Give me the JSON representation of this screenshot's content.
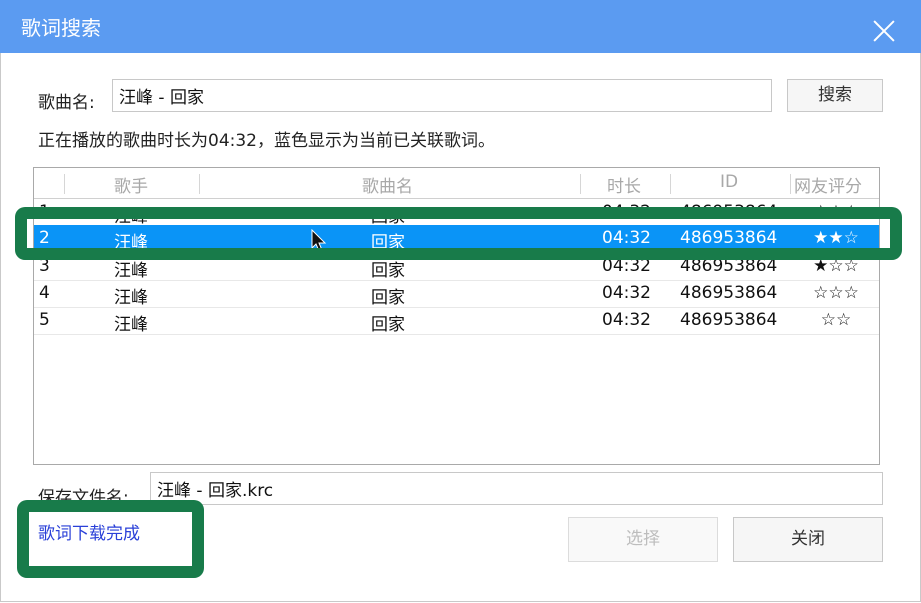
{
  "window": {
    "title": "歌词搜索",
    "close_icon": "close-icon"
  },
  "search": {
    "label": "歌曲名:",
    "value": "汪峰 - 回家",
    "button": "搜索"
  },
  "info_text": "正在播放的歌曲时长为04:32，蓝色显示为当前已关联歌词。",
  "table": {
    "columns": [
      "歌手",
      "歌曲名",
      "时长",
      "ID",
      "网友评分"
    ],
    "rows": [
      {
        "index": "1",
        "singer": "汪峰",
        "song": "回家",
        "duration": "04:32",
        "id": "486953864",
        "rating": "☆☆☆"
      },
      {
        "index": "2",
        "singer": "汪峰",
        "song": "回家",
        "duration": "04:32",
        "id": "486953864",
        "rating": "★★☆",
        "selected": true
      },
      {
        "index": "3",
        "singer": "汪峰",
        "song": "回家",
        "duration": "04:32",
        "id": "486953864",
        "rating": "★☆☆"
      },
      {
        "index": "4",
        "singer": "汪峰",
        "song": "回家",
        "duration": "04:32",
        "id": "486953864",
        "rating": "☆☆☆"
      },
      {
        "index": "5",
        "singer": "汪峰",
        "song": "回家",
        "duration": "04:32",
        "id": "486953864",
        "rating": "☆☆"
      }
    ]
  },
  "save": {
    "label": "保存文件名:",
    "value": "汪峰 - 回家.krc"
  },
  "status_link": "歌词下载完成",
  "buttons": {
    "select": "选择",
    "close": "关闭"
  },
  "colors": {
    "titlebar": "#5b9bf1",
    "selected_row": "#0a94f7",
    "highlight_box": "#187b4a",
    "link": "#2a40d8"
  }
}
